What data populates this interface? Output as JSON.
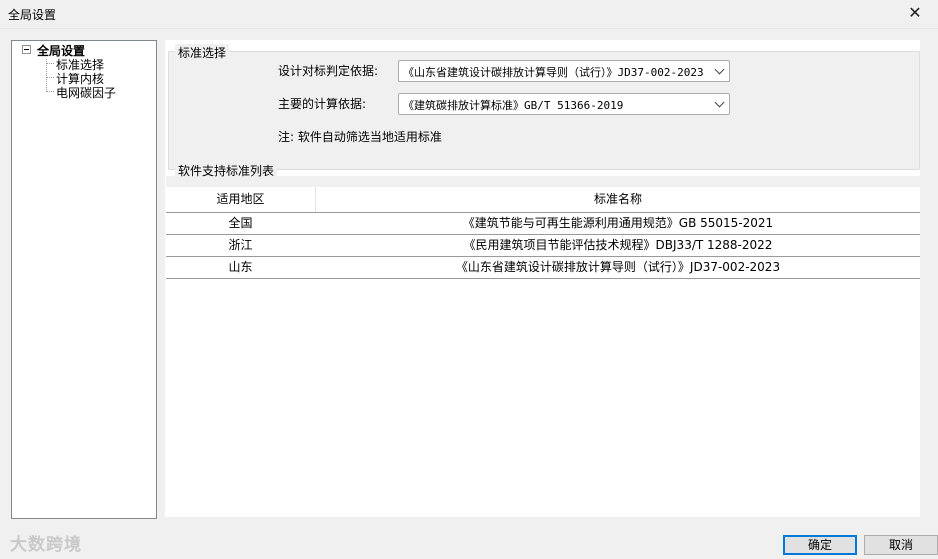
{
  "window": {
    "title": "全局设置",
    "close_glyph": "✕"
  },
  "tree": {
    "root": "全局设置",
    "items": [
      "标准选择",
      "计算内核",
      "电网碳因子"
    ]
  },
  "standard_selection": {
    "group_title": "标准选择",
    "design_label": "设计对标判定依据:",
    "design_value": "《山东省建筑设计碳排放计算导则（试行）》JD37-002-2023",
    "calc_label": "主要的计算依据:",
    "calc_value": "《建筑碳排放计算标准》GB/T 51366-2019",
    "note": "注: 软件自动筛选当地适用标准"
  },
  "list": {
    "title": "软件支持标准列表",
    "headers": [
      "适用地区",
      "标准名称"
    ],
    "rows": [
      {
        "region": "全国",
        "name": "《建筑节能与可再生能源利用通用规范》GB 55015-2021"
      },
      {
        "region": "浙江",
        "name": "《民用建筑项目节能评估技术规程》DBJ33/T 1288-2022"
      },
      {
        "region": "山东",
        "name": "《山东省建筑设计碳排放计算导则（试行）》JD37-002-2023"
      }
    ]
  },
  "watermark": "大数跨境",
  "buttons": {
    "ok": "确定",
    "cancel": "取消"
  }
}
